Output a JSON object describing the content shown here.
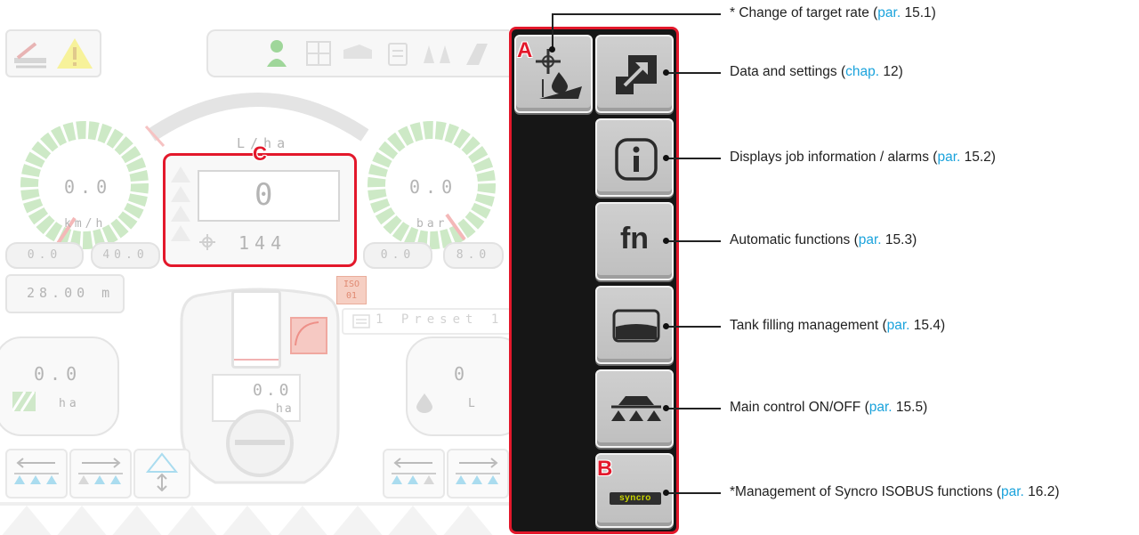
{
  "screen": {
    "speed": {
      "value": "0.0",
      "unit": "km/h",
      "range_min": "0.0",
      "range_max": "40.0"
    },
    "pressure": {
      "value": "0.0",
      "unit": "bar",
      "range_min": "0.0",
      "range_max": "8.0"
    },
    "rate": {
      "unit": "L/ha",
      "current": "0",
      "target": "144"
    },
    "boom_width": "28.00 m",
    "iso_badge": "ISO\n01",
    "preset_label": "1 Preset 1",
    "area": {
      "value": "0.0",
      "unit": "ha"
    },
    "tank_counter": {
      "value": "0.0",
      "unit": "ha"
    },
    "volume": {
      "value": "0",
      "unit": "L"
    }
  },
  "softkeys": [
    {
      "id": "target-rate",
      "marker": "A"
    },
    {
      "id": "data-settings"
    },
    {
      "id": "job-info"
    },
    {
      "id": "auto-functions",
      "label": "fn"
    },
    {
      "id": "tank-filling"
    },
    {
      "id": "main-control"
    },
    {
      "id": "syncro",
      "marker": "B",
      "logo": "syncro"
    }
  ],
  "area_marker": "C",
  "callouts": [
    {
      "pre": "* Change of target rate (",
      "ref": "par.",
      "num": " 15.1)"
    },
    {
      "pre": "Data and settings (",
      "ref": "chap.",
      "num": " 12)"
    },
    {
      "pre": "Displays job information / alarms (",
      "ref": "par.",
      "num": " 15.2)"
    },
    {
      "pre": "Automatic functions (",
      "ref": "par.",
      "num": " 15.3)"
    },
    {
      "pre": "Tank filling management (",
      "ref": "par.",
      "num": " 15.4)"
    },
    {
      "pre": "Main control ON/OFF (",
      "ref": "par.",
      "num": " 15.5)"
    },
    {
      "pre": "*Management of Syncro ISOBUS functions (",
      "ref": "par.",
      "num": " 16.2)"
    }
  ],
  "colors": {
    "accent_red": "#e3182b",
    "reference_blue": "#1ba3dc",
    "gauge_green": "#cde9c6",
    "warning_yellow": "#f7f29a"
  }
}
